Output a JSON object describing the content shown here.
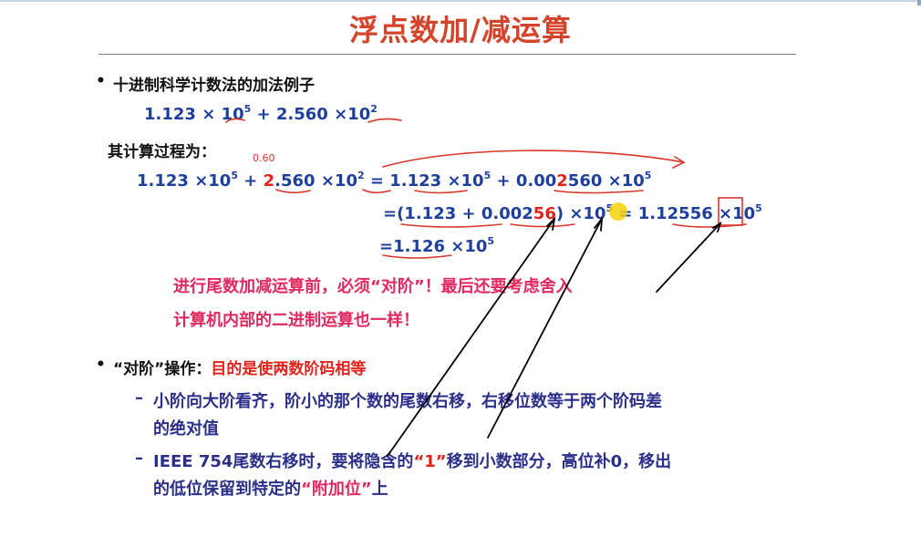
{
  "title": "浮点数加/减运算",
  "bullet1": "十进制科学计数法的加法例子",
  "example": {
    "a_mant": "1.123 × 10",
    "a_exp": "5",
    "b_mant": " + 2.560 ×10",
    "b_exp": "2"
  },
  "process_label": "其计算过程为：",
  "note_060": "0.60",
  "line1": {
    "p1": "1.123 ×10",
    "e1": "5",
    "p2": " + ",
    "p3": "2",
    "p4": ".560 ×10",
    "e2": "2",
    "p5": " = 1.123 ×10",
    "e3": "5",
    "p6": " + 0.00",
    "p7": "2",
    "p8": "560 ×10",
    "e4": "5"
  },
  "line2": {
    "p1": "=(1.123 + 0.002",
    "p2": "56",
    "p3": ") ×10",
    "e1": "5",
    "p4": " = 1.12556 ×10",
    "e2": "5"
  },
  "line3": {
    "p1": "=1.126 ×10",
    "e1": "5"
  },
  "warning_line1": "进行尾数加减运算前，必须“对阶”！最后还要考虑舍入",
  "warning_line2": "计算机内部的二进制运算也一样！",
  "bullet2": {
    "label": "“对阶”操作：",
    "highlight": "目的是使两数阶码相等"
  },
  "sub1": {
    "dash": "–",
    "line1": "小阶向大阶看齐，阶小的那个数的尾数右移，右移位数等于两个阶码差",
    "line2": "的绝对值"
  },
  "sub2": {
    "dash": "–",
    "p1": "IEEE 754尾数右移时，要将隐含的",
    "p2": "“1”",
    "p3": "移到小数部分，高位补0，移出",
    "l2a": "的低位保留到特定的",
    "l2b": "“附加位”",
    "l2c": "上"
  },
  "colors": {
    "title": "#d4442b",
    "math_blue": "#1f3f9c",
    "red": "#e2221b",
    "pink": "#e0295e",
    "navy": "#2b2f8a",
    "pen_red": "#d9362b"
  }
}
